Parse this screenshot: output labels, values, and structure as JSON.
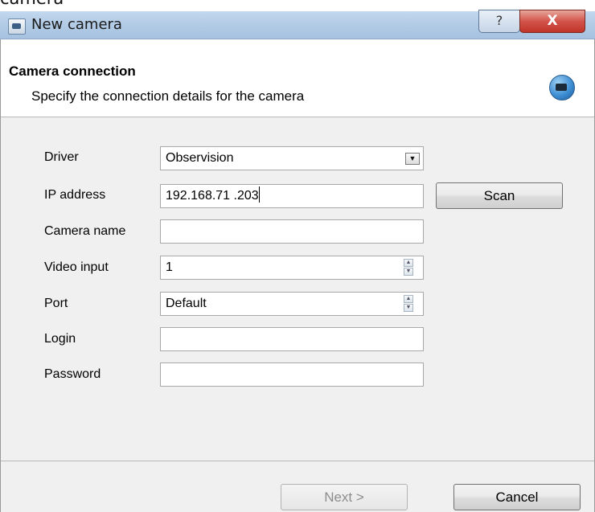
{
  "top_text": "camera",
  "window": {
    "title": "New camera",
    "help_glyph": "?",
    "close_glyph": "X"
  },
  "header": {
    "title": "Camera connection",
    "subtitle": "Specify the connection details for the camera",
    "icon": "camera-icon"
  },
  "form": {
    "driver": {
      "label": "Driver",
      "value": "Observision"
    },
    "ip_address": {
      "label": "IP address",
      "value": "192.168.71 .203"
    },
    "camera_name": {
      "label": "Camera name",
      "value": ""
    },
    "video_input": {
      "label": "Video input",
      "value": "1"
    },
    "port": {
      "label": "Port",
      "value": "Default"
    },
    "login": {
      "label": "Login",
      "value": ""
    },
    "password": {
      "label": "Password",
      "value": ""
    }
  },
  "buttons": {
    "scan": "Scan",
    "next": "Next >",
    "cancel": "Cancel"
  }
}
